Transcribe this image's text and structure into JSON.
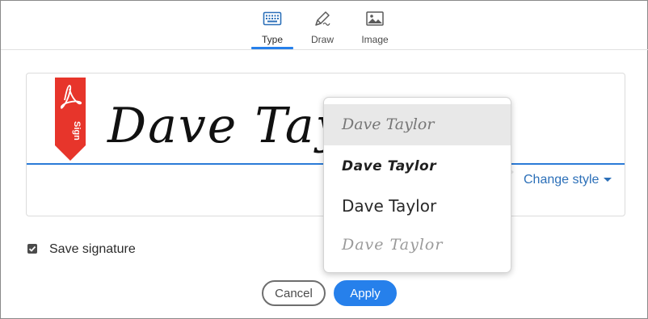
{
  "tabs": [
    {
      "label": "Type",
      "icon": "keyboard-icon",
      "active": true
    },
    {
      "label": "Draw",
      "icon": "pen-icon",
      "active": false
    },
    {
      "label": "Image",
      "icon": "image-icon",
      "active": false
    }
  ],
  "signature": {
    "ribbon_text": "Sign",
    "text": "Dave Taylor",
    "change_style_label": "Change style"
  },
  "style_menu": {
    "options": [
      {
        "label": "Dave Taylor",
        "selected": true
      },
      {
        "label": "Dave Taylor",
        "selected": false
      },
      {
        "label": "Dave Taylor",
        "selected": false
      },
      {
        "label": "Dave Taylor",
        "selected": false
      }
    ]
  },
  "save_signature": {
    "label": "Save signature",
    "checked": true
  },
  "buttons": {
    "cancel": "Cancel",
    "apply": "Apply"
  },
  "colors": {
    "accent": "#2680eb",
    "ribbon": "#e7352b",
    "link": "#2b6fb8"
  }
}
